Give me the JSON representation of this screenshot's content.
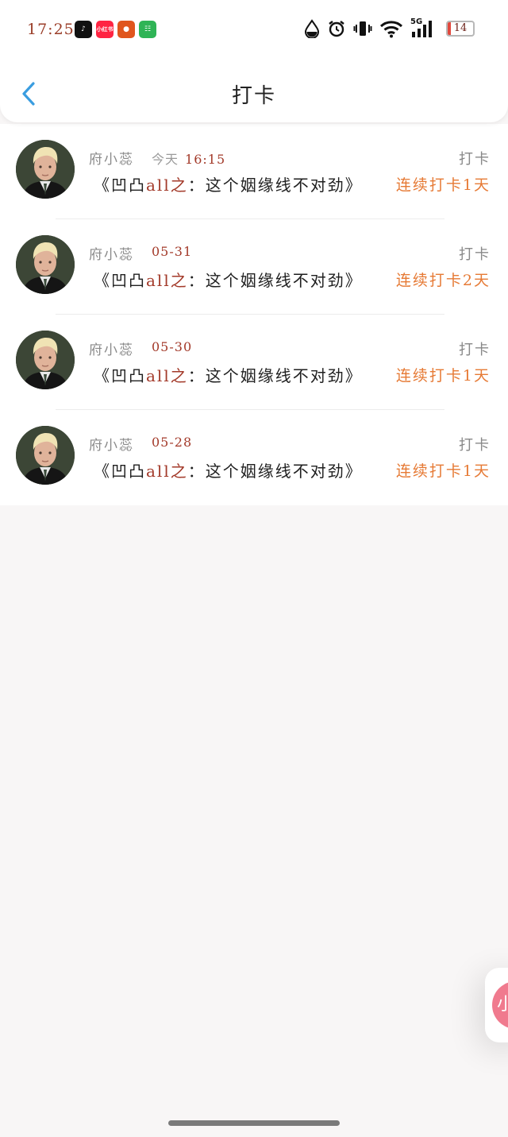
{
  "status_bar": {
    "time": "17:25",
    "apps": [
      {
        "icon": "tiktok-icon",
        "color": "#111111",
        "text": "♪"
      },
      {
        "icon": "xiaohongshu-icon",
        "color": "#ff2442",
        "text": "小红书"
      },
      {
        "icon": "pumpkin-app-icon",
        "color": "#e0561d",
        "text": "●"
      },
      {
        "icon": "green-app-icon",
        "color": "#2fb456",
        "text": "☷"
      }
    ],
    "network": "5G",
    "battery": "14",
    "battery_level": 0.14
  },
  "nav": {
    "title": "打卡"
  },
  "checkins": [
    {
      "name": "府小蕊",
      "date_prefix": "今天",
      "date": "16:15",
      "type": "打卡",
      "title_open": "《凹凸",
      "title_highlight": "all之",
      "title_rest": "：这个姻缘线不对劲》",
      "streak": "连续打卡1天"
    },
    {
      "name": "府小蕊",
      "date_prefix": "",
      "date": "05-31",
      "type": "打卡",
      "title_open": "《凹凸",
      "title_highlight": "all之",
      "title_rest": "：这个姻缘线不对劲》",
      "streak": "连续打卡2天"
    },
    {
      "name": "府小蕊",
      "date_prefix": "",
      "date": "05-30",
      "type": "打卡",
      "title_open": "《凹凸",
      "title_highlight": "all之",
      "title_rest": "：这个姻缘线不对劲》",
      "streak": "连续打卡1天"
    },
    {
      "name": "府小蕊",
      "date_prefix": "",
      "date": "05-28",
      "type": "打卡",
      "title_open": "《凹凸",
      "title_highlight": "all之",
      "title_rest": "：这个姻缘线不对劲》",
      "streak": "连续打卡1天"
    }
  ],
  "floating_button": {
    "label": "小"
  },
  "colors": {
    "accent_back": "#3a9de0",
    "streak": "#e67a35",
    "date": "#a33a2a",
    "background": "#f8f6f6"
  }
}
